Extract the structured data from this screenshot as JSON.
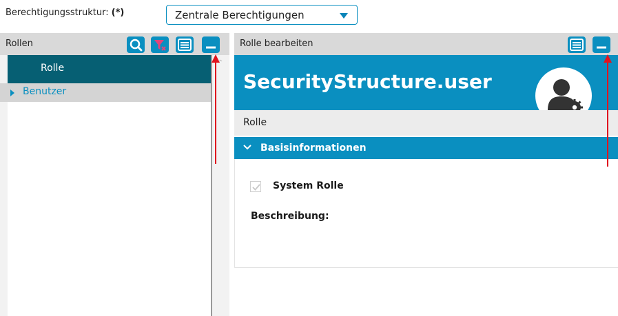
{
  "toolbar": {
    "structure_label": "Berechtigungsstruktur:",
    "required_mark": "(*)",
    "structure_value": "Zentrale Berechtigungen"
  },
  "left_panel": {
    "title": "Rollen",
    "buttons": {
      "search_icon": "search-icon",
      "filter_clear_icon": "filter-clear-icon",
      "menu_icon": "menu-icon",
      "minimize_icon": "minimize-icon"
    },
    "tree": [
      {
        "label": "Rolle",
        "selected": true
      },
      {
        "label": "Benutzer",
        "selected": false,
        "expandable": true
      }
    ]
  },
  "right_panel": {
    "title": "Rolle bearbeiten",
    "banner_title": "SecurityStructure.user",
    "subtitle": "Rolle",
    "section_title": "Basisinformationen",
    "fields": {
      "system_role_label": "System Rolle",
      "system_role_checked": true,
      "description_label": "Beschreibung:"
    }
  },
  "colors": {
    "accent": "#0a8fc0",
    "selected_row": "#065f73",
    "annotation_arrow": "#e0141e",
    "filter_icon": "#e0457b"
  }
}
